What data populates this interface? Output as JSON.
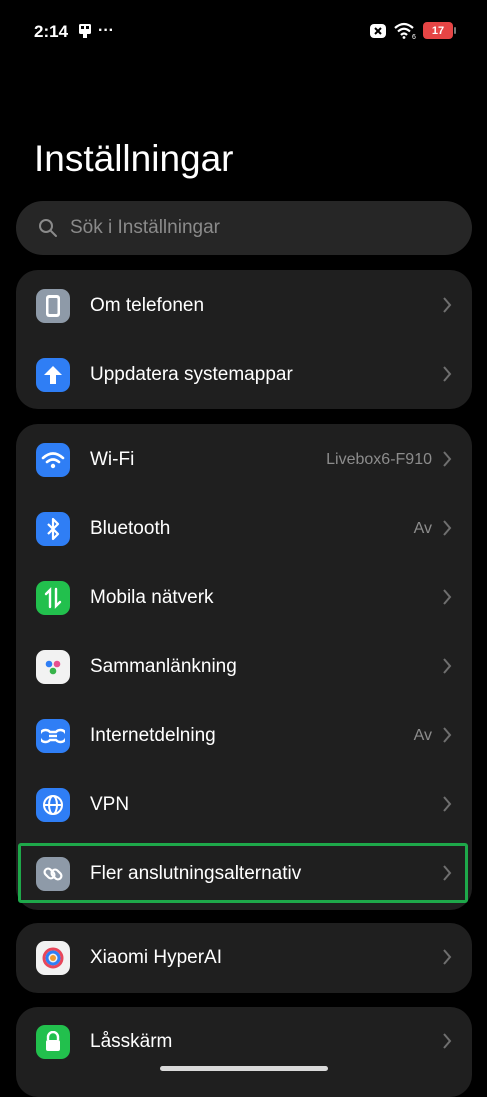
{
  "status": {
    "time": "2:14",
    "dots": "···",
    "battery": "17",
    "wifi_mark": "6"
  },
  "page": {
    "title": "Inställningar"
  },
  "search": {
    "placeholder": "Sök i Inställningar"
  },
  "group1": {
    "items": [
      {
        "label": "Om telefonen",
        "icon": "phone-icon",
        "color": "#8e9aa8"
      },
      {
        "label": "Uppdatera systemappar",
        "icon": "arrow-up-icon",
        "color": "#2f7ef5"
      }
    ]
  },
  "group2": {
    "items": [
      {
        "label": "Wi-Fi",
        "value": "Livebox6-F910",
        "icon": "wifi-icon",
        "color": "#2f7ef5"
      },
      {
        "label": "Bluetooth",
        "value": "Av",
        "icon": "bluetooth-icon",
        "color": "#2f7ef5"
      },
      {
        "label": "Mobila nätverk",
        "icon": "mobile-data-icon",
        "color": "#22c04d"
      },
      {
        "label": "Sammanlänkning",
        "icon": "interconnect-icon",
        "color": "#f2f2f2"
      },
      {
        "label": "Internetdelning",
        "value": "Av",
        "icon": "hotspot-icon",
        "color": "#2f7ef5"
      },
      {
        "label": "VPN",
        "icon": "globe-icon",
        "color": "#2f7ef5"
      },
      {
        "label": "Fler anslutningsalternativ",
        "icon": "link-icon",
        "color": "#8e9aa8"
      }
    ]
  },
  "group3": {
    "items": [
      {
        "label": "Xiaomi HyperAI",
        "icon": "hyperai-icon",
        "color": "#f2f2f2"
      }
    ]
  },
  "group4": {
    "items": [
      {
        "label": "Låsskärm",
        "icon": "lock-icon",
        "color": "#22c04d"
      }
    ]
  }
}
